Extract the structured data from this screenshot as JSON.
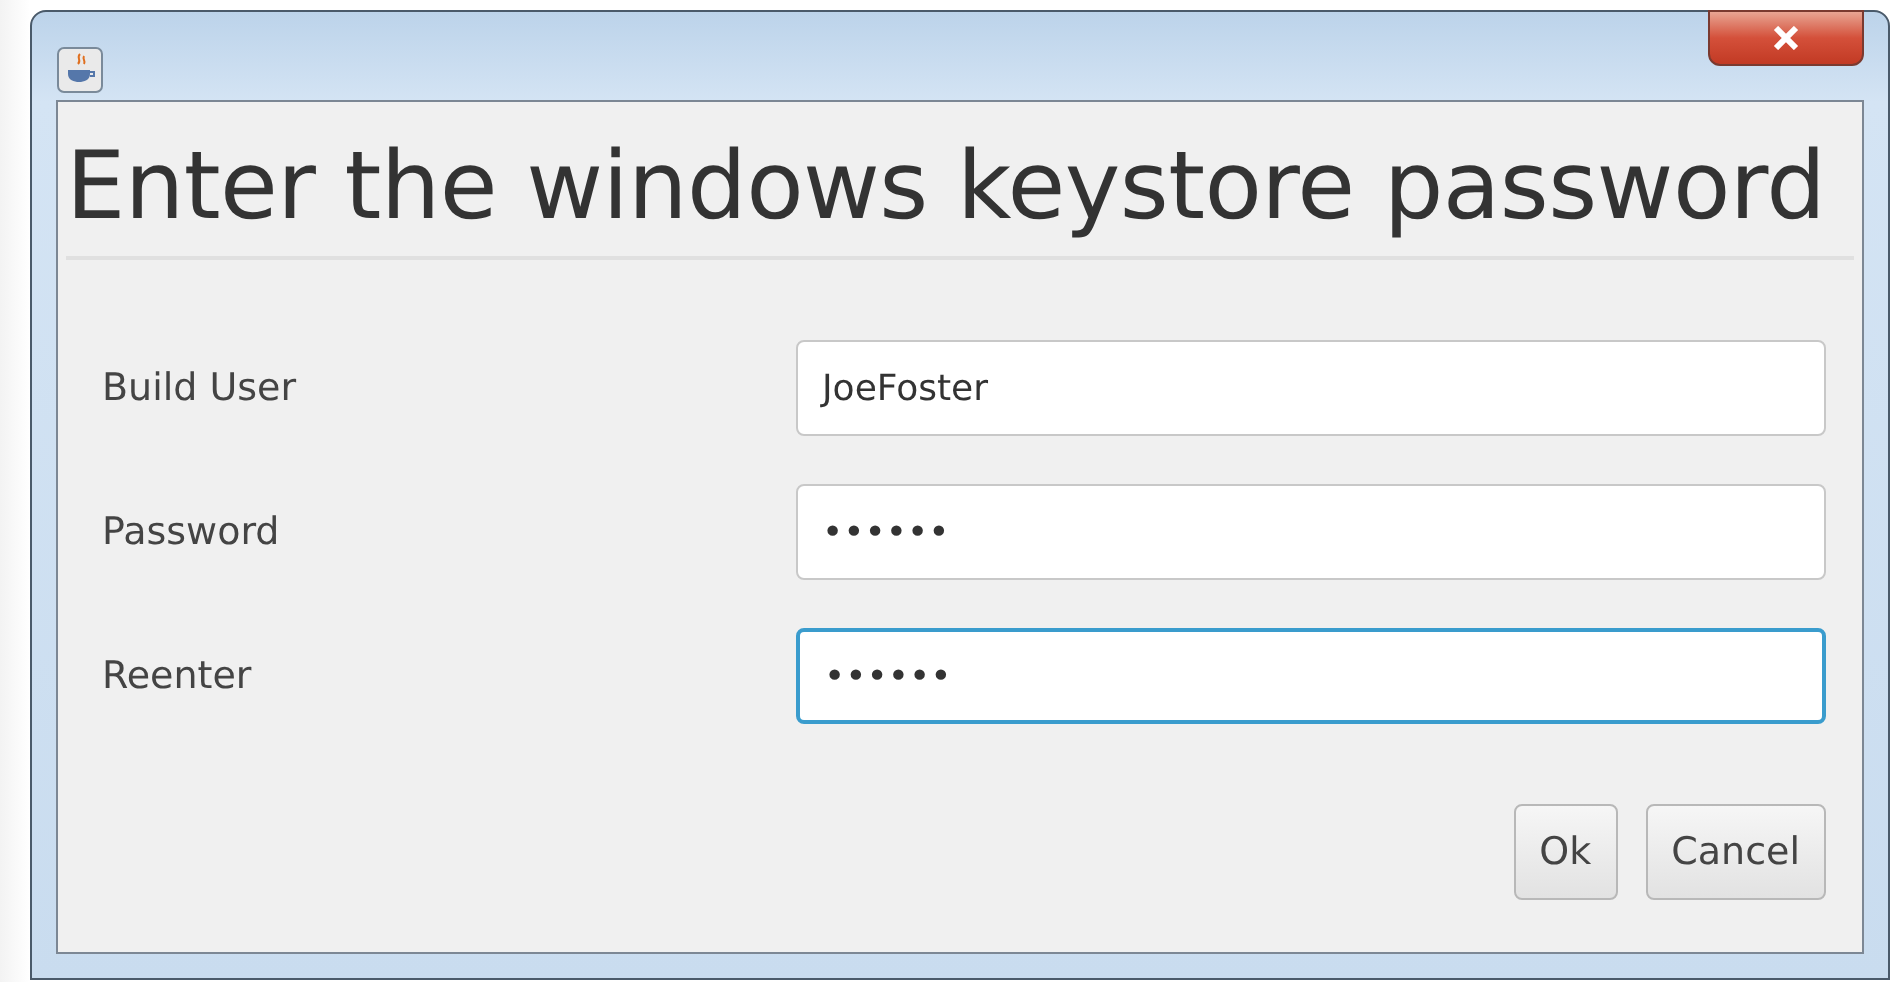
{
  "heading": "Enter the windows keystore password",
  "fields": [
    {
      "label": "Build User",
      "value": "JoeFoster",
      "focused": false
    },
    {
      "label": "Password",
      "value": "••••••",
      "focused": false
    },
    {
      "label": "Reenter",
      "value": "••••••",
      "focused": true
    }
  ],
  "buttons": [
    "Ok",
    "Cancel"
  ]
}
